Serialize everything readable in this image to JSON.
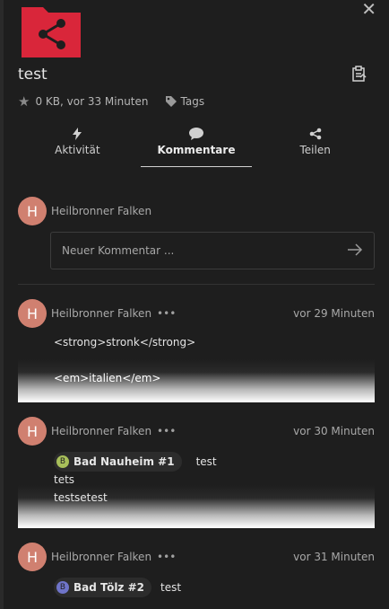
{
  "file": {
    "title": "test",
    "size": "0 KB, vor 33 Minuten",
    "tags_label": "Tags",
    "folder_color": "#d9263a"
  },
  "tabs": [
    {
      "label": "Aktivität",
      "icon": "bolt-icon"
    },
    {
      "label": "Kommentare",
      "icon": "comment-icon",
      "active": true
    },
    {
      "label": "Teilen",
      "icon": "share-icon"
    }
  ],
  "new_comment": {
    "author_initial": "H",
    "author": "Heilbronner Falken",
    "placeholder": "Neuer Kommentar ..."
  },
  "comments": [
    {
      "initial": "H",
      "author": "Heilbronner Falken",
      "time": "vor 29 Minuten",
      "line1": "<strong>stronk</strong>",
      "line2": "<em>italien</em>"
    },
    {
      "initial": "H",
      "author": "Heilbronner Falken",
      "time": "vor 30 Minuten",
      "mention": {
        "initial": "B",
        "name": "Bad Nauheim #1",
        "color": "#a8bf5a"
      },
      "after_mention": "test",
      "line2": "tets",
      "line3": "testsetest"
    },
    {
      "initial": "H",
      "author": "Heilbronner Falken",
      "time": "vor 31 Minuten",
      "mention": {
        "initial": "B",
        "name": "Bad Tölz #2",
        "color": "#6f74c9"
      },
      "after_mention": "test"
    }
  ],
  "more_label": "•••"
}
